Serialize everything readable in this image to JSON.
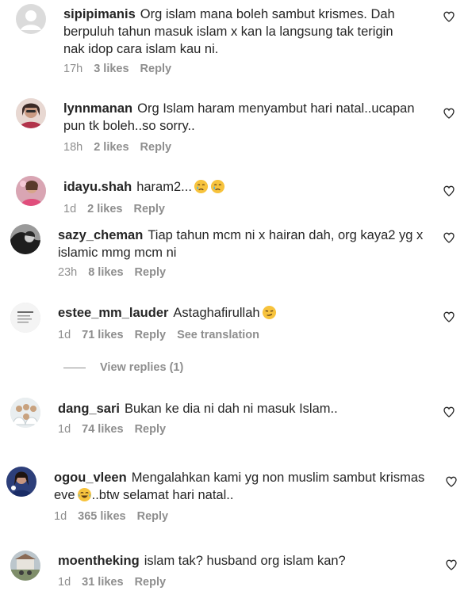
{
  "comments": [
    {
      "username": "sipipimanis",
      "text": "Org islam mana boleh sambut krismes. Dah berpuluh tahun masuk islam x kan la langsung tak terigin nak idop cara islam kau ni.",
      "time": "17h",
      "likes": "3 likes",
      "reply": "Reply"
    },
    {
      "username": "lynnmanan",
      "text": "Org Islam haram menyambut hari natal..ucapan pun tk boleh..so sorry..",
      "time": "18h",
      "likes": "2 likes",
      "reply": "Reply"
    },
    {
      "username": "idayu.shah",
      "text": "haram2...",
      "emoji_suffix": [
        "crying-face",
        "crying-face"
      ],
      "time": "1d",
      "likes": "2 likes",
      "reply": "Reply"
    },
    {
      "username": "sazy_cheman",
      "text": "Tiap tahun mcm ni x hairan dah, org kaya2 yg x islamic mmg mcm ni",
      "time": "23h",
      "likes": "8 likes",
      "reply": "Reply"
    },
    {
      "username": "estee_mm_lauder",
      "text": "Astaghafirullah",
      "emoji_suffix": [
        "smirk-face"
      ],
      "time": "1d",
      "likes": "71 likes",
      "reply": "Reply",
      "see_translation": "See translation"
    },
    {
      "username": "dang_sari",
      "text": "Bukan ke dia ni dah ni masuk Islam..",
      "time": "1d",
      "likes": "74 likes",
      "reply": "Reply"
    },
    {
      "username": "ogou_vleen",
      "text_before_emoji": "Mengalahkan kami yg non muslim sambut krismas eve",
      "inline_emoji": "laughing-face",
      "text_after_emoji": "..btw selamat hari natal..",
      "time": "1d",
      "likes": "365 likes",
      "reply": "Reply"
    },
    {
      "username": "moentheking",
      "text": "islam tak? husband org islam kan?",
      "time": "1d",
      "likes": "31 likes",
      "reply": "Reply"
    }
  ],
  "view_replies": "View replies (1)",
  "colors": {
    "text": "#262626",
    "meta": "#8e8e8e",
    "background": "#ffffff"
  },
  "icons": {
    "like": "heart-outline-icon"
  }
}
